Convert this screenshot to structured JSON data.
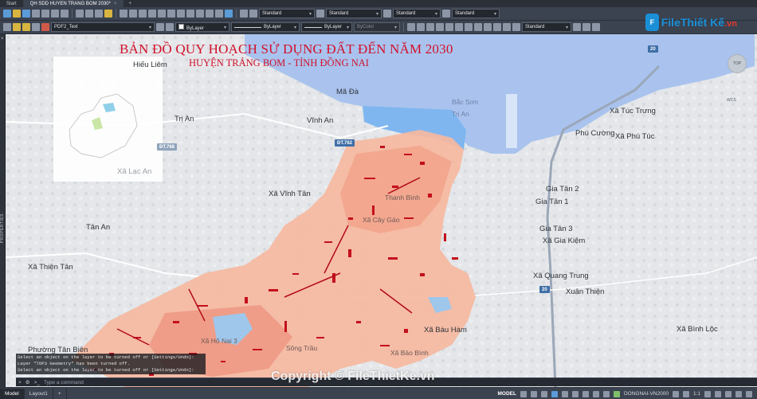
{
  "tabs": [
    {
      "label": "Start",
      "active": false
    },
    {
      "label": "QH SDD HUYEN TRANG BOM 2030*",
      "active": true
    }
  ],
  "toolbar1": {
    "text_style": "Standard",
    "dim_style": "Standard",
    "table_style": "Standard",
    "mleader_style": "Standard"
  },
  "toolbar2": {
    "layer": "PDF2_Text",
    "color": "ByLayer",
    "linetype": "ByLayer",
    "lineweight": "ByLayer",
    "plotstyle": "ByColor",
    "view_style": "Standard"
  },
  "side_palette_label": "PROPERTIES",
  "map": {
    "title": "BẢN ĐỒ QUY HOẠCH SỬ DỤNG ĐẤT ĐẾN NĂM 2030",
    "subtitle": "HUYỆN TRẢNG BOM - TỈNH ĐỒNG NAI",
    "colors": {
      "title": "#d2102a",
      "water": "#a9c3ee",
      "land_use": "#f6b8a0",
      "residential": "#e8645a",
      "road_red": "#c4101c"
    },
    "places": [
      {
        "name": "Hiếu Liêm"
      },
      {
        "name": "Mã Đà"
      },
      {
        "name": "Trị An"
      },
      {
        "name": "Vĩnh An"
      },
      {
        "name": "Xã Túc Trưng"
      },
      {
        "name": "Phú Cường"
      },
      {
        "name": "Xã Phú Túc"
      },
      {
        "name": "Xã Vĩnh Tân"
      },
      {
        "name": "Gia Tân 2"
      },
      {
        "name": "Gia Tân 1"
      },
      {
        "name": "Gia Tân 3"
      },
      {
        "name": "Xã Gia Kiệm"
      },
      {
        "name": "Tân An"
      },
      {
        "name": "Xã Thiện Tân"
      },
      {
        "name": "Xã Quang Trung"
      },
      {
        "name": "Xuân Thiện"
      },
      {
        "name": "Xã Bình Lộc"
      },
      {
        "name": "Phường Tân Biên"
      },
      {
        "name": "Xã Lạc An"
      },
      {
        "name": "Sông Trầu"
      },
      {
        "name": "Xã Hố Nai 3"
      },
      {
        "name": "Thanh Bình"
      },
      {
        "name": "Xã Cây Gáo"
      },
      {
        "name": "Xã Bảo Bình"
      },
      {
        "name": "Trị An"
      },
      {
        "name": "Bắc Sơn"
      },
      {
        "name": "Xã Bàu Hàm"
      }
    ],
    "road_shields": [
      "20",
      "ĐT.762",
      "20",
      "ĐT.768"
    ],
    "viewcube_label": "TOP",
    "wcs_label": "WCS"
  },
  "logo": {
    "mark": "F",
    "text": "FileThiết Kế",
    "suffix": ".vn"
  },
  "command_history": [
    "Select an object on the layer to be turned off or [Settings/Undo]:",
    "Layer \"TOP3 Geometry\" has been turned off.",
    "Select an object on the layer to be turned off or [Settings/Undo]:"
  ],
  "command_placeholder": "Type a command",
  "watermark": "Copyright © FileThietKe.vn",
  "status": {
    "tabs": [
      {
        "label": "Model",
        "active": true
      },
      {
        "label": "Layout1",
        "active": false
      }
    ],
    "mode": "MODEL",
    "coordinate_system": "DONGNAI-VN2000",
    "scale": "1:1"
  }
}
